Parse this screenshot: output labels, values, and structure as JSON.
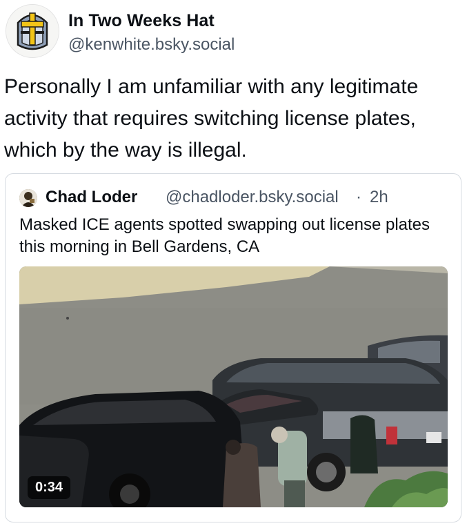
{
  "post": {
    "author_name": "In Two Weeks Hat",
    "author_handle": "@kenwhite.bsky.social",
    "avatar_icon": "helmet-cross-avatar-icon",
    "text": "Personally I am unfamiliar with any legitimate activity that requires switching license plates, which by the way is illegal."
  },
  "quote": {
    "author_name": "Chad Loder",
    "author_handle": "@chadloder.bsky.social",
    "separator": "·",
    "time": "2h",
    "text": "Masked ICE agents spotted swapping out license plates this morning in Bell Gardens, CA",
    "video": {
      "duration": "0:34",
      "description_icon": "video-thumbnail"
    }
  },
  "colors": {
    "text_primary": "#0b0f14",
    "text_secondary": "#4a5563",
    "card_border": "#d6dbe1"
  }
}
